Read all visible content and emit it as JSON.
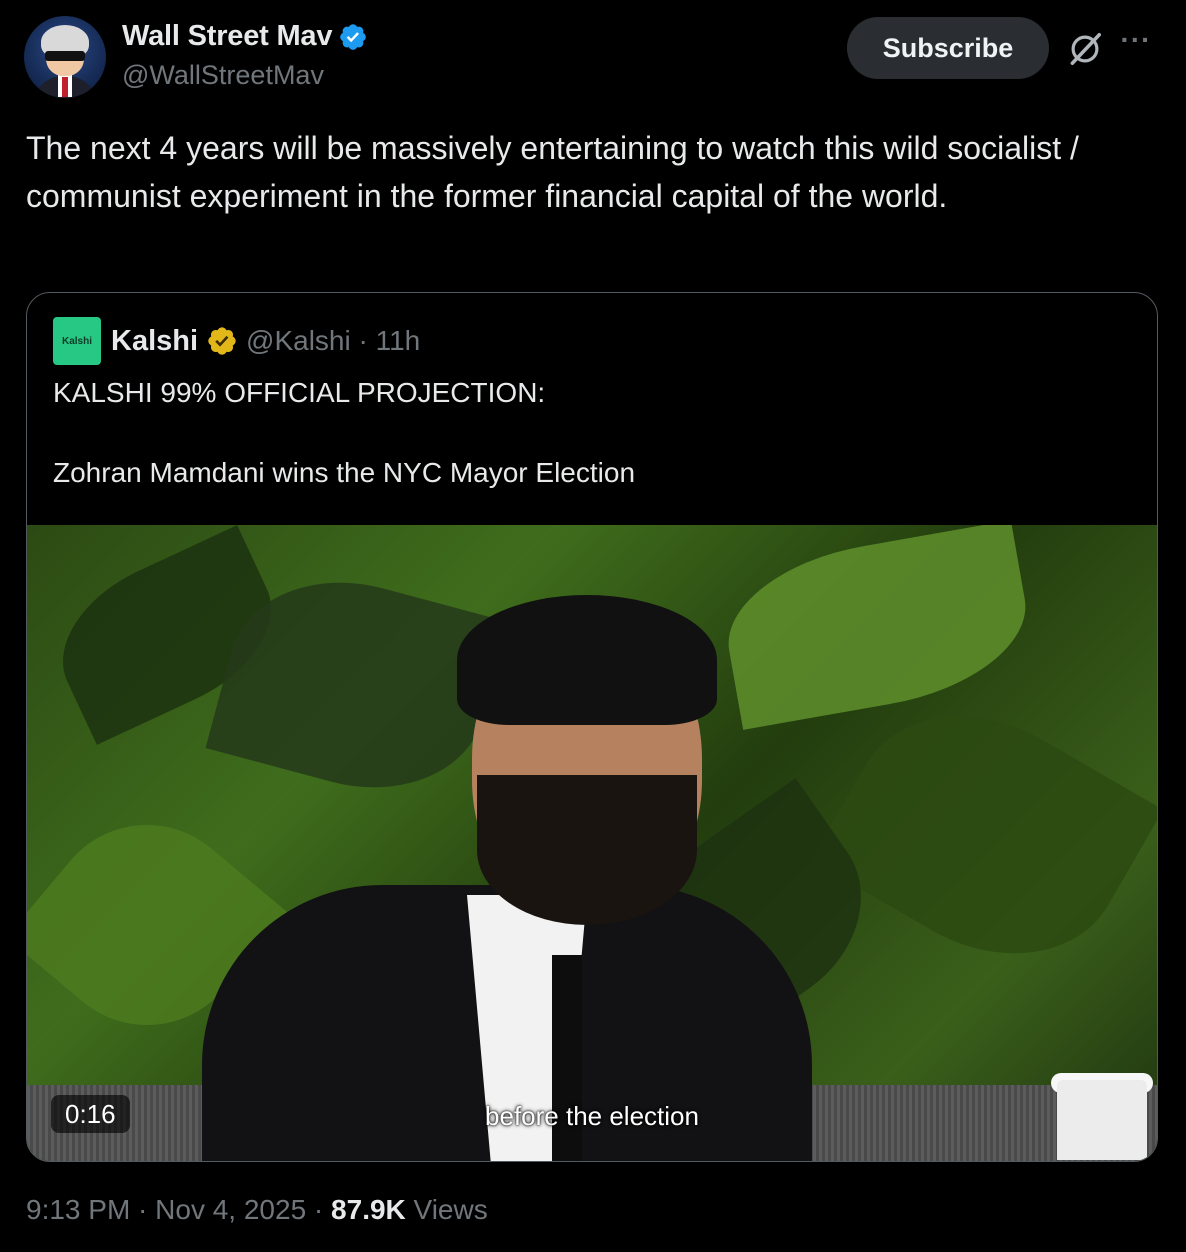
{
  "author": {
    "name": "Wall Street Mav",
    "handle": "@WallStreetMav",
    "verified_color": "#1d9bf0"
  },
  "actions": {
    "subscribe_label": "Subscribe",
    "grok_icon": "grok-icon",
    "more_icon": "more-icon",
    "more_glyph": "···"
  },
  "tweet": {
    "text": "The next 4 years will be massively entertaining to watch this wild socialist / communist experiment in the former financial capital of the world."
  },
  "quoted": {
    "logo_text": "Kalshi",
    "name": "Kalshi",
    "handle_time": "@Kalshi · 11h",
    "badge_color": "#e2b719",
    "line1": "KALSHI 99% OFFICIAL PROJECTION:",
    "line2": "Zohran Mamdani wins the NYC Mayor Election",
    "video": {
      "duration": "0:16",
      "caption": "before the election"
    }
  },
  "meta": {
    "time_date": "9:13 PM · Nov 4, 2025 · ",
    "views_count": "87.9K",
    "views_label": " Views"
  }
}
